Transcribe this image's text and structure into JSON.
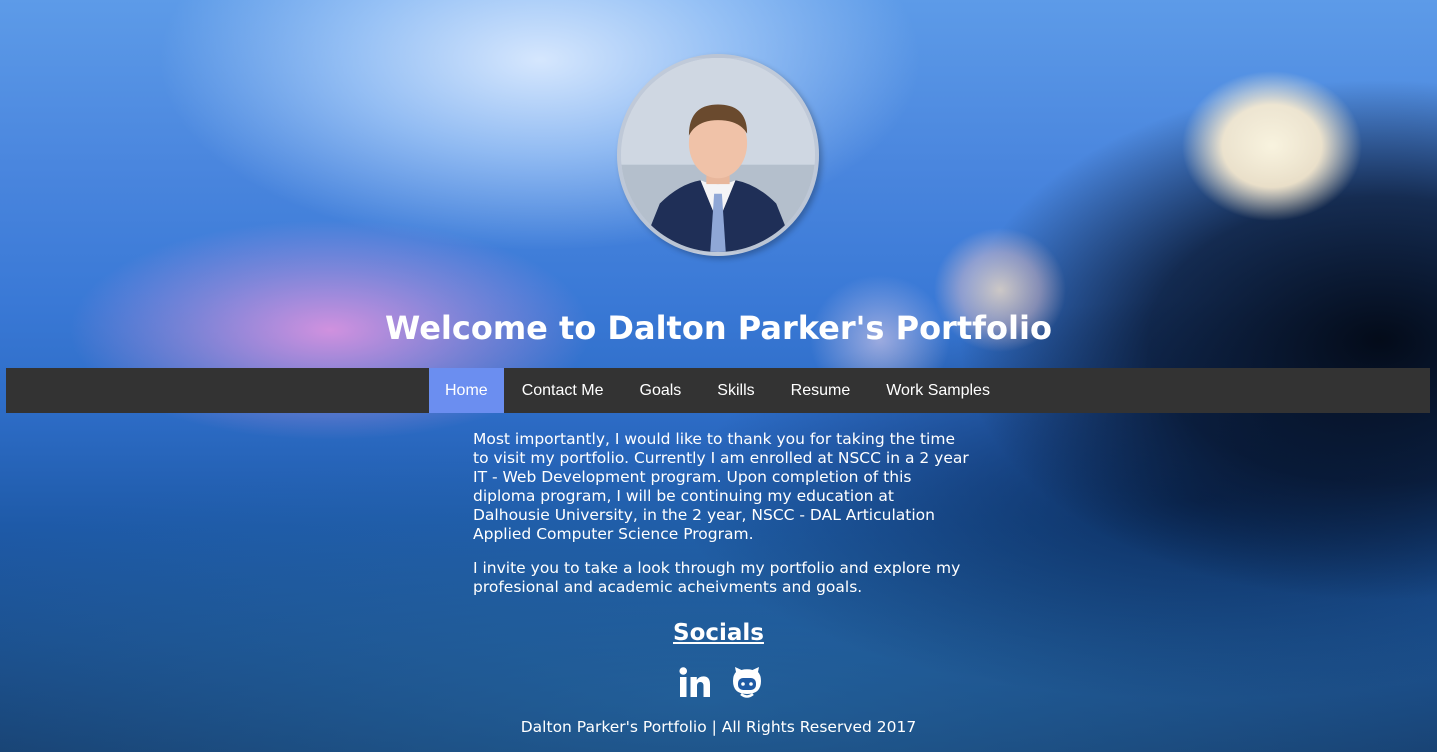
{
  "header": {
    "profile_photo_alt": "Dalton Parker",
    "title": "Welcome to Dalton Parker's Portfolio"
  },
  "nav": {
    "items": [
      {
        "label": "Home",
        "active": true
      },
      {
        "label": "Contact Me",
        "active": false
      },
      {
        "label": "Goals",
        "active": false
      },
      {
        "label": "Skills",
        "active": false
      },
      {
        "label": "Resume",
        "active": false
      },
      {
        "label": "Work Samples",
        "active": false
      }
    ],
    "colors": {
      "bar": "#333333",
      "active": "#6b8ef0"
    }
  },
  "main": {
    "paragraphs": [
      "Most importantly, I would like to thank you for taking the time to visit my portfolio. Currently I am enrolled at NSCC in a 2 year IT - Web Development program. Upon completion of this diploma program, I will be continuing my education at Dalhousie University, in the 2 year, NSCC - DAL Articulation Applied Computer Science Program.",
      "I invite you to take a look through my portfolio and explore my profesional and academic acheivments and goals."
    ]
  },
  "socials": {
    "heading": "Socials",
    "links": [
      {
        "icon": "linkedin-icon"
      },
      {
        "icon": "github-icon"
      }
    ]
  },
  "footer": {
    "text": "Dalton Parker's Portfolio | All Rights Reserved 2017"
  }
}
